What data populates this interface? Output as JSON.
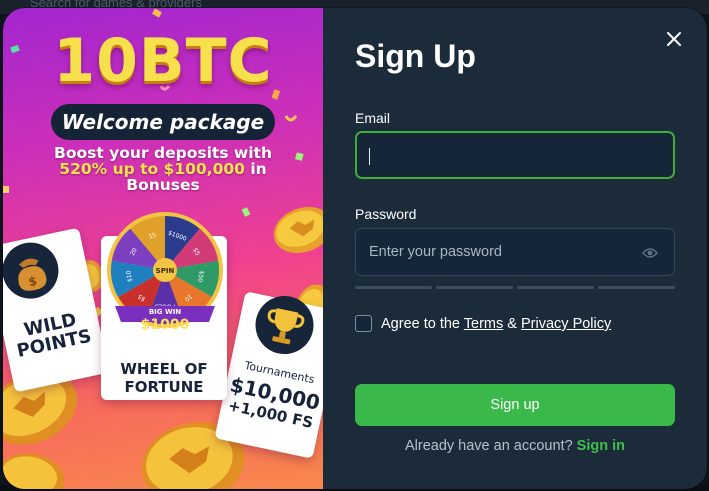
{
  "background": {
    "search_placeholder": "Search for games & providers"
  },
  "promo": {
    "amount_title": "10BTC",
    "welcome_label": "Welcome package",
    "boost_line1": "Boost your deposits with",
    "boost_highlight": "520% up to $100,000",
    "boost_in": "in",
    "boost_line3": "Bonuses",
    "card_wild": {
      "line1": "WILD",
      "line2": "POINTS"
    },
    "card_wheel": {
      "line1": "WHEEL OF",
      "line2": "FORTUNE",
      "big_win": "BIG WIN",
      "prize": "$1000",
      "center": "SPIN"
    },
    "wheel_values": [
      "$1000",
      "$5",
      "$50",
      "10",
      "POOLS",
      "$5",
      "$10",
      "20",
      "15"
    ],
    "card_tournaments": {
      "heading": "Tournaments",
      "amount": "$10,000",
      "extra": "+1,000 FS"
    }
  },
  "form": {
    "title": "Sign Up",
    "email_label": "Email",
    "email_value": "",
    "password_label": "Password",
    "password_placeholder": "Enter your password",
    "agree_prefix": "Agree to the",
    "terms_label": "Terms",
    "and_symbol": "&",
    "privacy_label": "Privacy Policy",
    "submit_label": "Sign up",
    "already_text": "Already have an account?",
    "signin_label": "Sign in"
  },
  "colors": {
    "accent_green": "#3bb84a",
    "panel_bg": "#1b2b3a",
    "input_bg": "#142638",
    "title_yellow": "#f6e04c"
  },
  "icons": {
    "close": "close-icon",
    "eye": "eye-icon",
    "money_bag": "money-bag-icon",
    "trophy": "trophy-icon",
    "coin": "coin-icon"
  }
}
